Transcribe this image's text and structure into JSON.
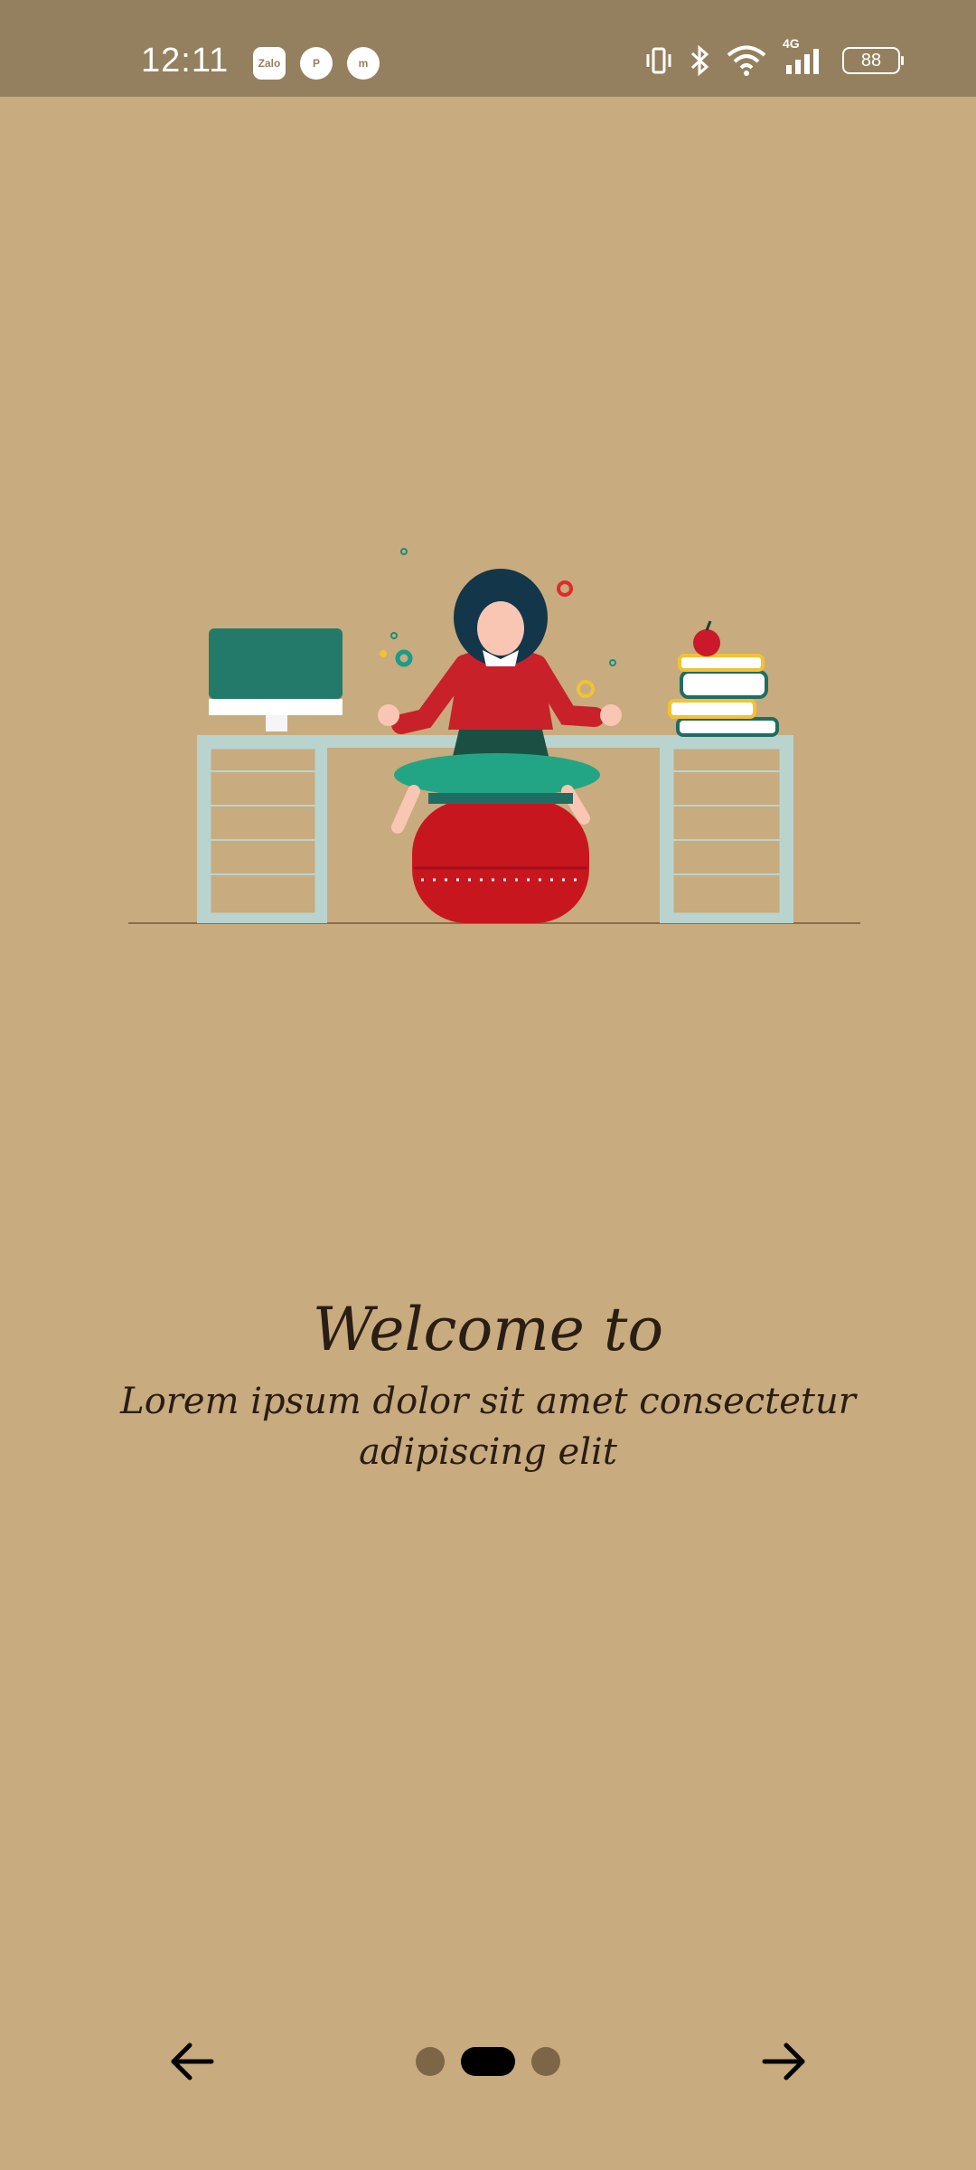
{
  "status_bar": {
    "time": "12:11",
    "notifications": [
      {
        "name": "zalo-icon",
        "label": "Zalo"
      },
      {
        "name": "pinterest-icon",
        "label": "P"
      },
      {
        "name": "messenger-icon",
        "label": "m"
      }
    ],
    "network": "4G",
    "battery": "88"
  },
  "onboarding": {
    "title": "Welcome to",
    "subtitle": "Lorem ipsum dolor sit amet consectetur adipiscing elit",
    "current_page": 2,
    "total_pages": 3
  },
  "icons": {
    "back": "arrow-left-icon",
    "next": "arrow-right-icon"
  },
  "colors": {
    "background": "#c8ab7e",
    "status_bar": "#94805e",
    "dot_inactive": "#7d6648",
    "dot_active": "#000000"
  }
}
